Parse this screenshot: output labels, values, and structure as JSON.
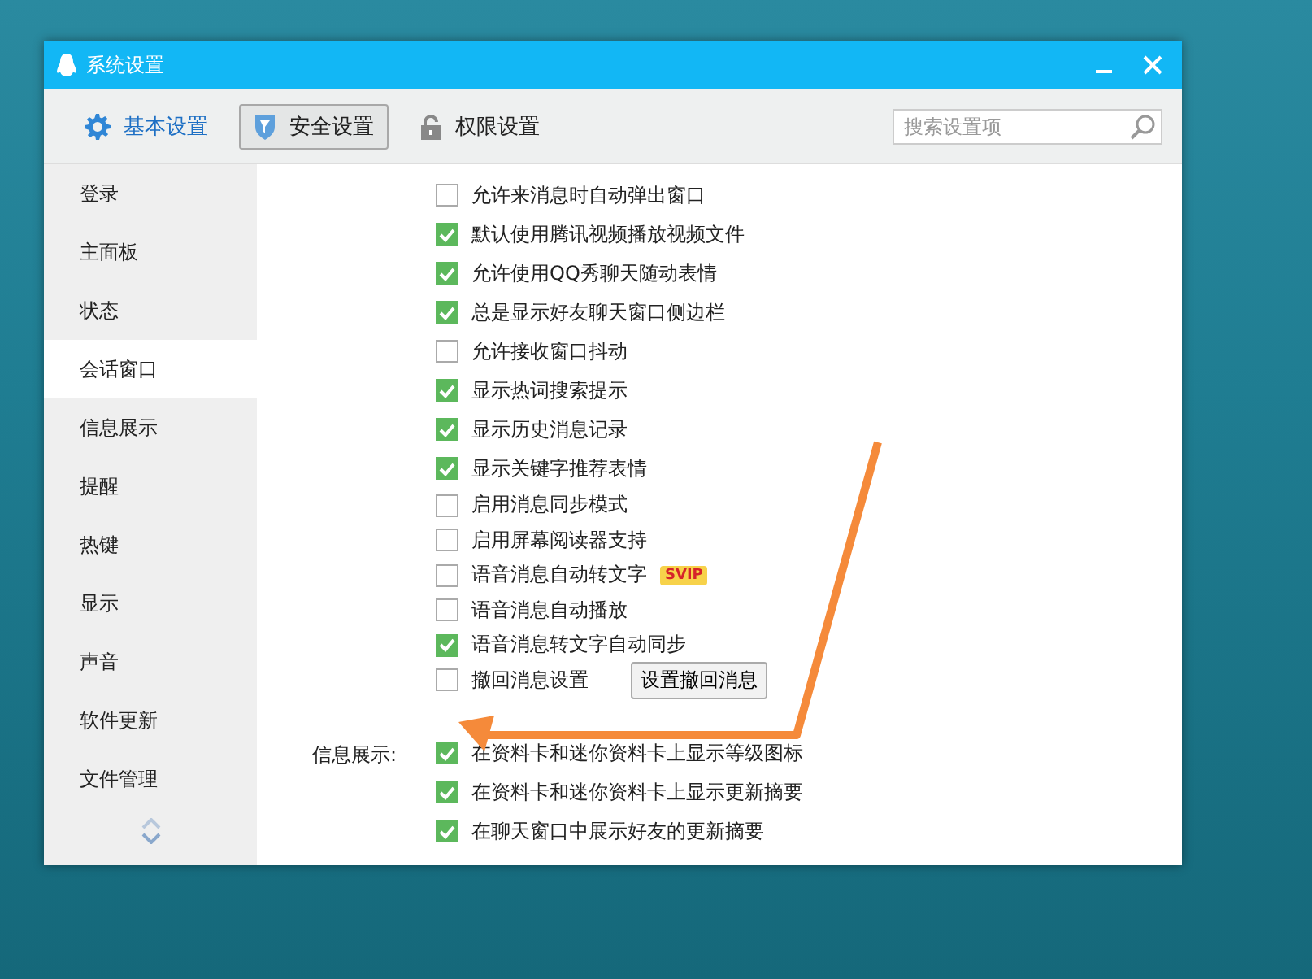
{
  "window": {
    "title": "系统设置"
  },
  "toolbar": {
    "tabs": [
      {
        "label": "基本设置",
        "kind": "gear",
        "selected": false
      },
      {
        "label": "安全设置",
        "kind": "shield",
        "selected": true
      },
      {
        "label": "权限设置",
        "kind": "lock",
        "selected": false
      }
    ],
    "search": {
      "placeholder": "搜索设置项"
    }
  },
  "sidebar": {
    "items": [
      {
        "label": "登录",
        "selected": false
      },
      {
        "label": "主面板",
        "selected": false
      },
      {
        "label": "状态",
        "selected": false
      },
      {
        "label": "会话窗口",
        "selected": true
      },
      {
        "label": "信息展示",
        "selected": false
      },
      {
        "label": "提醒",
        "selected": false
      },
      {
        "label": "热键",
        "selected": false
      },
      {
        "label": "显示",
        "selected": false
      },
      {
        "label": "声音",
        "selected": false
      },
      {
        "label": "软件更新",
        "selected": false
      },
      {
        "label": "文件管理",
        "selected": false
      }
    ]
  },
  "sections": [
    {
      "items": [
        {
          "label": "允许来消息时自动弹出窗口",
          "checked": false
        },
        {
          "label": "默认使用腾讯视频播放视频文件",
          "checked": true
        },
        {
          "label": "允许使用QQ秀聊天随动表情",
          "checked": true
        },
        {
          "label": "总是显示好友聊天窗口侧边栏",
          "checked": true
        },
        {
          "label": "允许接收窗口抖动",
          "checked": false
        },
        {
          "label": "显示热词搜索提示",
          "checked": true
        },
        {
          "label": "显示历史消息记录",
          "checked": true
        },
        {
          "label": "显示关键字推荐表情",
          "checked": true
        },
        {
          "label": "启用消息同步模式",
          "checked": false
        },
        {
          "label": "启用屏幕阅读器支持",
          "checked": false
        },
        {
          "label": "语音消息自动转文字",
          "checked": false,
          "badge": "SVIP"
        },
        {
          "label": "语音消息自动播放",
          "checked": false
        },
        {
          "label": "语音消息转文字自动同步",
          "checked": true
        },
        {
          "label": "撤回消息设置",
          "checked": false,
          "button": "设置撤回消息"
        }
      ]
    },
    {
      "label": "信息展示:",
      "items": [
        {
          "label": "在资料卡和迷你资料卡上显示等级图标",
          "checked": true
        },
        {
          "label": "在资料卡和迷你资料卡上显示更新摘要",
          "checked": true
        },
        {
          "label": "在聊天窗口中展示好友的更新摘要",
          "checked": true
        }
      ]
    }
  ]
}
